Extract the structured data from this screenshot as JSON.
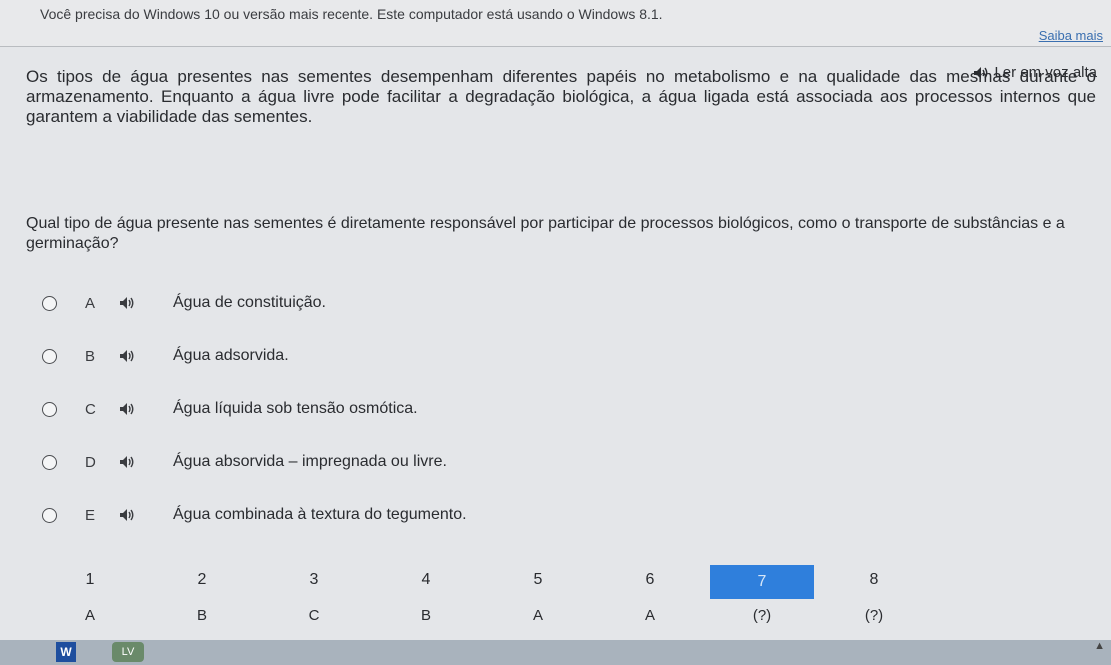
{
  "banner": {
    "text": "Você precisa do Windows 10 ou versão mais recente. Este computador está usando o Windows 8.1.",
    "link": "Saiba mais"
  },
  "read_aloud": {
    "label": "Ler em voz alta",
    "icon": "speaker-icon"
  },
  "passage": {
    "text": "Os tipos de água presentes nas sementes desempenham diferentes papéis no metabolismo e na qualidade das mesmas durante o armazenamento. Enquanto a água livre pode facilitar a degradação biológica, a água ligada está associada aos processos internos que garantem a viabilidade das sementes."
  },
  "question": {
    "text": "Qual tipo de água presente nas sementes é diretamente responsável por participar de processos biológicos, como o transporte de substâncias e a germinação?"
  },
  "options": [
    {
      "letter": "A",
      "text": "Água de constituição."
    },
    {
      "letter": "B",
      "text": "Água adsorvida."
    },
    {
      "letter": "C",
      "text": "Água líquida sob tensão osmótica."
    },
    {
      "letter": "D",
      "text": "Água absorvida – impregnada ou livre."
    },
    {
      "letter": "E",
      "text": "Água combinada à textura do tegumento."
    }
  ],
  "navigation": [
    {
      "num": "1",
      "answer": "A"
    },
    {
      "num": "2",
      "answer": "B"
    },
    {
      "num": "3",
      "answer": "C"
    },
    {
      "num": "4",
      "answer": "B"
    },
    {
      "num": "5",
      "answer": "A"
    },
    {
      "num": "6",
      "answer": "A"
    },
    {
      "num": "7",
      "answer": "(?)"
    },
    {
      "num": "8",
      "answer": "(?)"
    }
  ],
  "navigation_current": "7",
  "taskbar": {
    "word_icon_label": "W",
    "lv_icon_label": "LV"
  },
  "colors": {
    "background": "#e4e6e9",
    "accent": "#2f7fdc",
    "link": "#3a6fb0"
  }
}
